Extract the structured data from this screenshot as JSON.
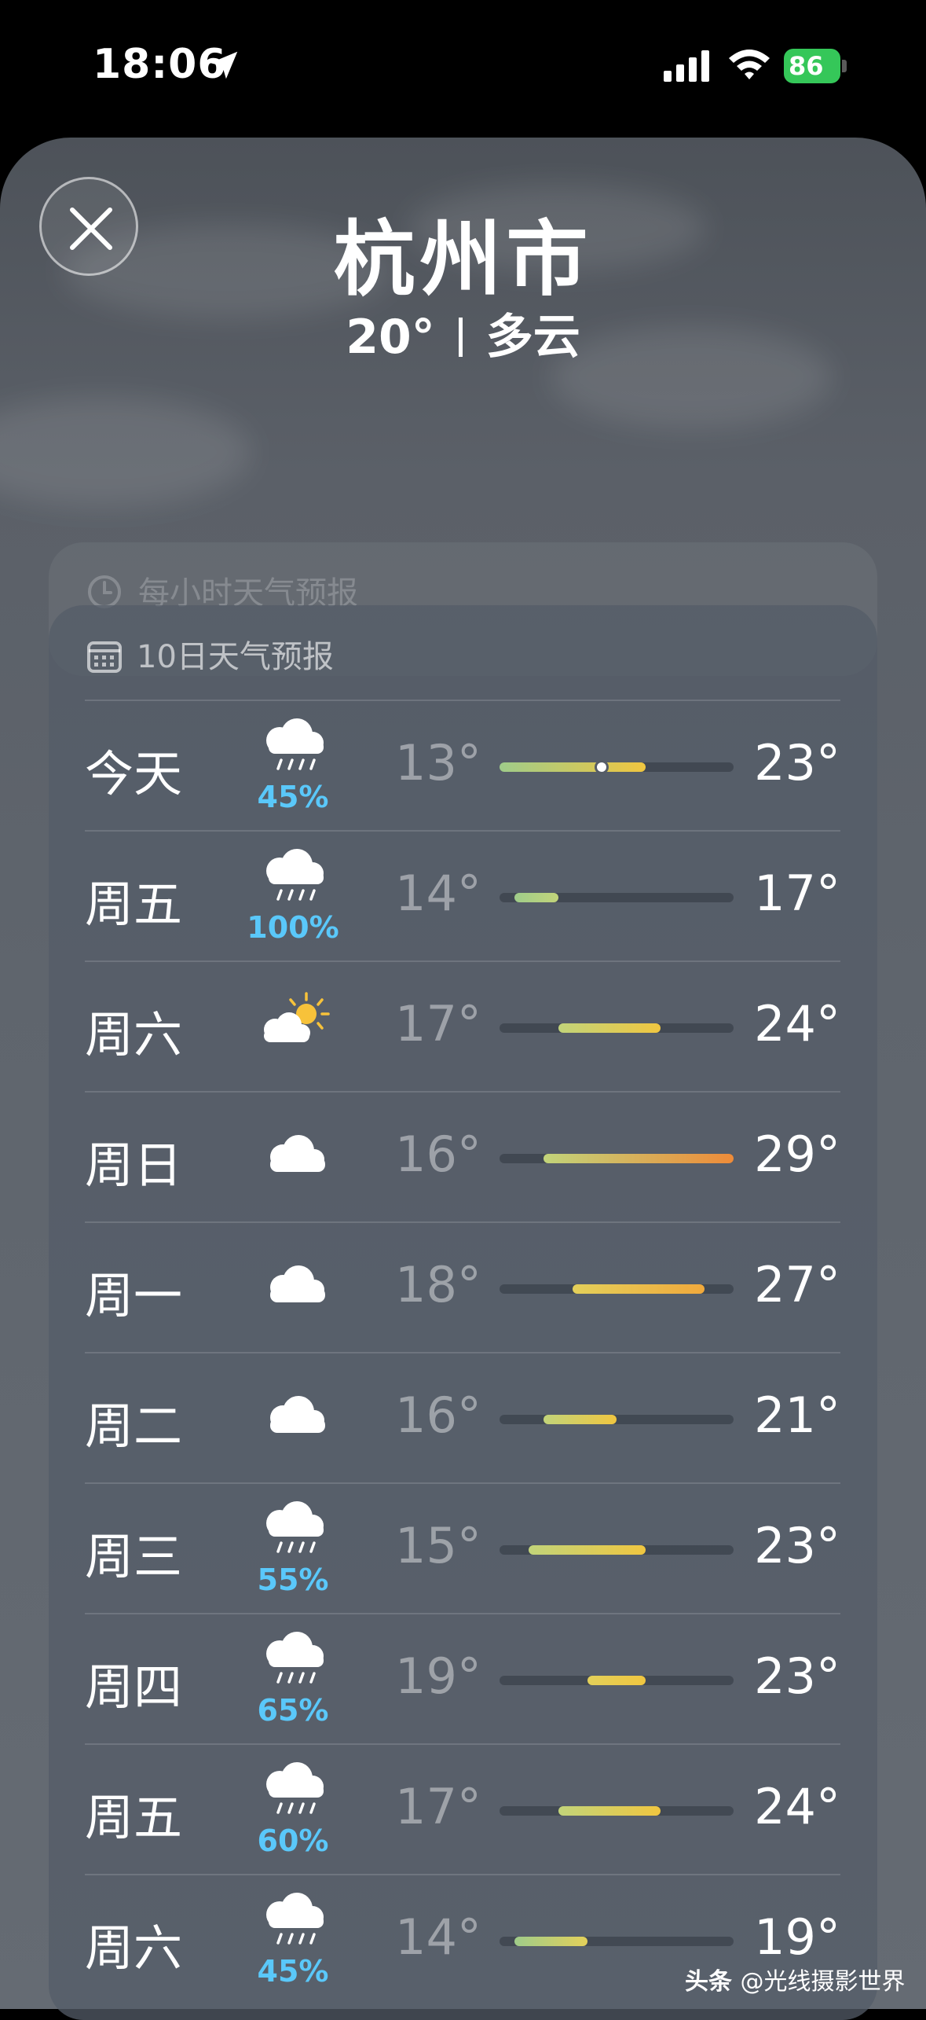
{
  "status_bar": {
    "time": "18:06",
    "battery": "86"
  },
  "location": {
    "city": "杭州市",
    "temperature": "20°",
    "condition": "多云"
  },
  "hourly_section": {
    "title": "每小时天气预报"
  },
  "forecast": {
    "title": "10日天气预报",
    "scale_min": 13,
    "scale_max": 29,
    "current_temp": 20,
    "days": [
      {
        "day": "今天",
        "icon": "rain-icon",
        "precip": "45%",
        "low": "13°",
        "high": "23°",
        "low_val": 13,
        "high_val": 23
      },
      {
        "day": "周五",
        "icon": "rain-icon",
        "precip": "100%",
        "low": "14°",
        "high": "17°",
        "low_val": 14,
        "high_val": 17
      },
      {
        "day": "周六",
        "icon": "partly-sunny-icon",
        "precip": "",
        "low": "17°",
        "high": "24°",
        "low_val": 17,
        "high_val": 24
      },
      {
        "day": "周日",
        "icon": "cloud-icon",
        "precip": "",
        "low": "16°",
        "high": "29°",
        "low_val": 16,
        "high_val": 29
      },
      {
        "day": "周一",
        "icon": "cloud-icon",
        "precip": "",
        "low": "18°",
        "high": "27°",
        "low_val": 18,
        "high_val": 27
      },
      {
        "day": "周二",
        "icon": "cloud-icon",
        "precip": "",
        "low": "16°",
        "high": "21°",
        "low_val": 16,
        "high_val": 21
      },
      {
        "day": "周三",
        "icon": "rain-icon",
        "precip": "55%",
        "low": "15°",
        "high": "23°",
        "low_val": 15,
        "high_val": 23
      },
      {
        "day": "周四",
        "icon": "rain-icon",
        "precip": "65%",
        "low": "19°",
        "high": "23°",
        "low_val": 19,
        "high_val": 23
      },
      {
        "day": "周五",
        "icon": "rain-icon",
        "precip": "60%",
        "low": "17°",
        "high": "24°",
        "low_val": 17,
        "high_val": 24
      },
      {
        "day": "周六",
        "icon": "rain-icon",
        "precip": "45%",
        "low": "14°",
        "high": "19°",
        "low_val": 14,
        "high_val": 19
      }
    ]
  },
  "watermark": {
    "platform": "头条",
    "account": "@光线摄影世界"
  }
}
